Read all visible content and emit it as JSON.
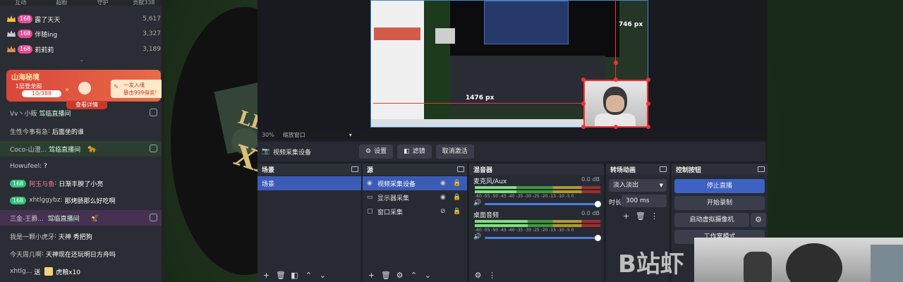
{
  "chat": {
    "tabs": [
      "互动",
      "超粉",
      "守护",
      "贡献338"
    ],
    "ranks": [
      {
        "level": "168",
        "name": "露了天天",
        "score": "5,617"
      },
      {
        "level": "168",
        "name": "伴随ing",
        "score": "3,327"
      },
      {
        "level": "168",
        "name": "莉莉莉",
        "score": "3,189"
      }
    ],
    "event": {
      "title": "山海秘境",
      "subtitle": "1层登龙阁",
      "progress": "10/388",
      "arrows": "»",
      "right_text_line1": "一发入魂",
      "right_text_line2": "暴击999得奖!",
      "detail": "查看详情"
    },
    "messages": [
      {
        "name": "Vv丶小贩",
        "text": "驾临直播间"
      },
      {
        "name": "生性今事有急",
        "text": "后面坐的谁"
      },
      {
        "name": "Coco-山澄...",
        "text": "驾临直播间"
      },
      {
        "name": "Howufeel",
        "text": "?"
      },
      {
        "badge": "168",
        "name": "阿玉与鱼",
        "text": "日渐丰腴了小亮"
      },
      {
        "badge": "168",
        "name": "xhtlggybz",
        "text": "那烤肠那么好吃啊"
      },
      {
        "name": "三金-王爵...",
        "text": "驾临直播间"
      },
      {
        "name": "我是一颗小虎牙",
        "text": "天神 秀把狗"
      },
      {
        "name": "今天周几啊",
        "text": "天神现在还玩明日方舟吗"
      },
      {
        "name": "xhtlg...",
        "text": "送",
        "gift": "虎粮x10"
      }
    ]
  },
  "obs": {
    "measure_width": "1476 px",
    "measure_height": "746 px",
    "zoom": "30%",
    "zoom_mode": "缩放窗口",
    "source_bar": {
      "source_name": "视频采集设备",
      "settings": "设置",
      "filters": "滤镜",
      "deactivate": "取消激活"
    },
    "scenes": {
      "title": "场景",
      "items": [
        "场景"
      ]
    },
    "sources": {
      "title": "源",
      "items": [
        "视频采集设备",
        "显示器采集",
        "窗口采集"
      ]
    },
    "mixer": {
      "title": "混音器",
      "tracks": [
        {
          "name": "麦克风/Aux",
          "db": "0.0 dB",
          "level": 0.33
        },
        {
          "name": "桌面音频",
          "db": "0.0 dB",
          "level": 0.42
        }
      ],
      "scale": "-60 -55 -50 -45 -40 -35 -30 -25 -20 -15 -10 -5 0"
    },
    "transitions": {
      "title": "转场动画",
      "selected": "淡入淡出",
      "duration_label": "时长",
      "duration": "300 ms"
    },
    "controls": {
      "title": "控制按钮",
      "stop_stream": "停止直播",
      "start_record": "开始录制",
      "virtual_cam": "启动虚拟摄像机",
      "studio_mode": "工作室模式"
    }
  },
  "watermark": "B站虾"
}
